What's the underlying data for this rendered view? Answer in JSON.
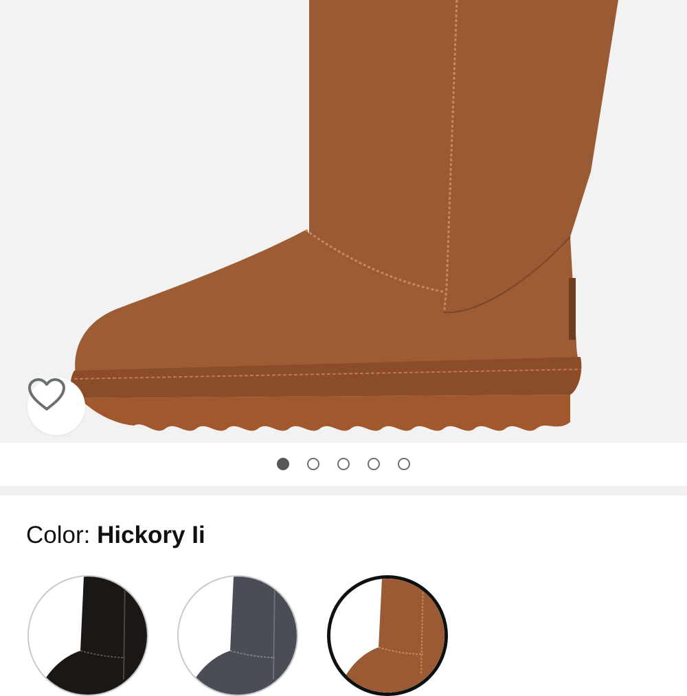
{
  "product": {
    "image_alt": "Boot product photo",
    "wishlist_icon": "heart-outline-icon"
  },
  "carousel": {
    "count": 5,
    "active_index": 0
  },
  "color": {
    "label": "Color:",
    "selected": "Hickory Ii",
    "swatches": [
      {
        "color": "#1b1715"
      },
      {
        "color": "#4a4d55"
      },
      {
        "color": "#8a4f2a"
      }
    ],
    "selected_swatch_index": 2
  },
  "colors": {
    "image_bg": "#f2f2f2",
    "boot": "#9c5b34",
    "dot_active": "#54585c",
    "text": "#0f1111"
  }
}
